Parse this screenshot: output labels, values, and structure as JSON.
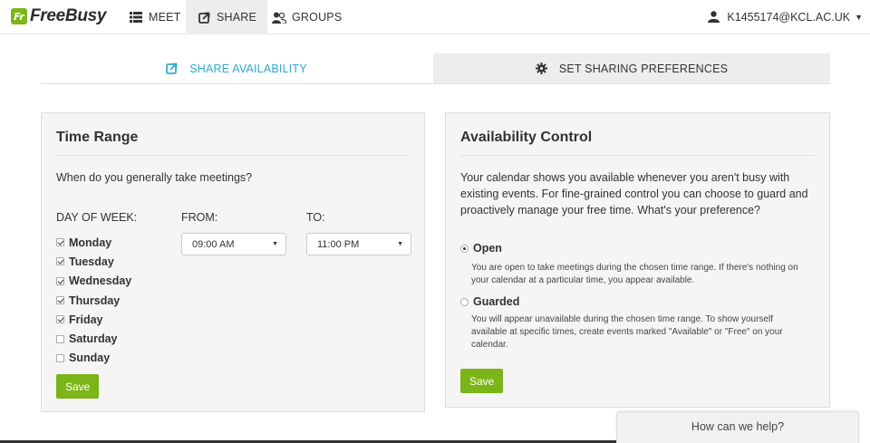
{
  "app": {
    "logo_text": "FreeBusy",
    "logo_badge": "Fr",
    "brand_color": "#7cb518",
    "accent_color": "#31a9d0"
  },
  "nav": {
    "tabs": [
      {
        "label": "MEET",
        "icon": "list-icon",
        "active": false
      },
      {
        "label": "SHARE",
        "icon": "share-icon",
        "active": true
      },
      {
        "label": "GROUPS",
        "icon": "users-icon",
        "active": false
      }
    ],
    "user": {
      "label": "K1455174@KCL.AC.UK",
      "icon": "user-icon"
    }
  },
  "subtabs": [
    {
      "label": "SHARE AVAILABILITY",
      "icon": "share-icon",
      "active": true
    },
    {
      "label": "SET SHARING PREFERENCES",
      "icon": "gear-icon",
      "active": false
    }
  ],
  "time_range": {
    "title": "Time Range",
    "question": "When do you generally take meetings?",
    "col_day": "DAY OF WEEK:",
    "col_from": "FROM:",
    "col_to": "TO:",
    "days": [
      {
        "label": "Monday",
        "checked": true
      },
      {
        "label": "Tuesday",
        "checked": true
      },
      {
        "label": "Wednesday",
        "checked": true
      },
      {
        "label": "Thursday",
        "checked": true
      },
      {
        "label": "Friday",
        "checked": true
      },
      {
        "label": "Saturday",
        "checked": false
      },
      {
        "label": "Sunday",
        "checked": false
      }
    ],
    "from_value": "09:00 AM",
    "to_value": "11:00 PM",
    "save_label": "Save"
  },
  "availability": {
    "title": "Availability Control",
    "description": "Your calendar shows you available whenever you aren't busy with existing events. For fine-grained control you can choose to guard and proactively manage your free time. What's your preference?",
    "options": [
      {
        "label": "Open",
        "selected": true,
        "desc": "You are open to take meetings during the chosen time range. If there's nothing on your calendar at a particular time, you appear available."
      },
      {
        "label": "Guarded",
        "selected": false,
        "desc": "You will appear unavailable during the chosen time range. To show yourself available at specific times, create events marked \"Available\" or \"Free\" on your calendar."
      }
    ],
    "save_label": "Save"
  },
  "help_widget": {
    "label": "How can we help?"
  }
}
